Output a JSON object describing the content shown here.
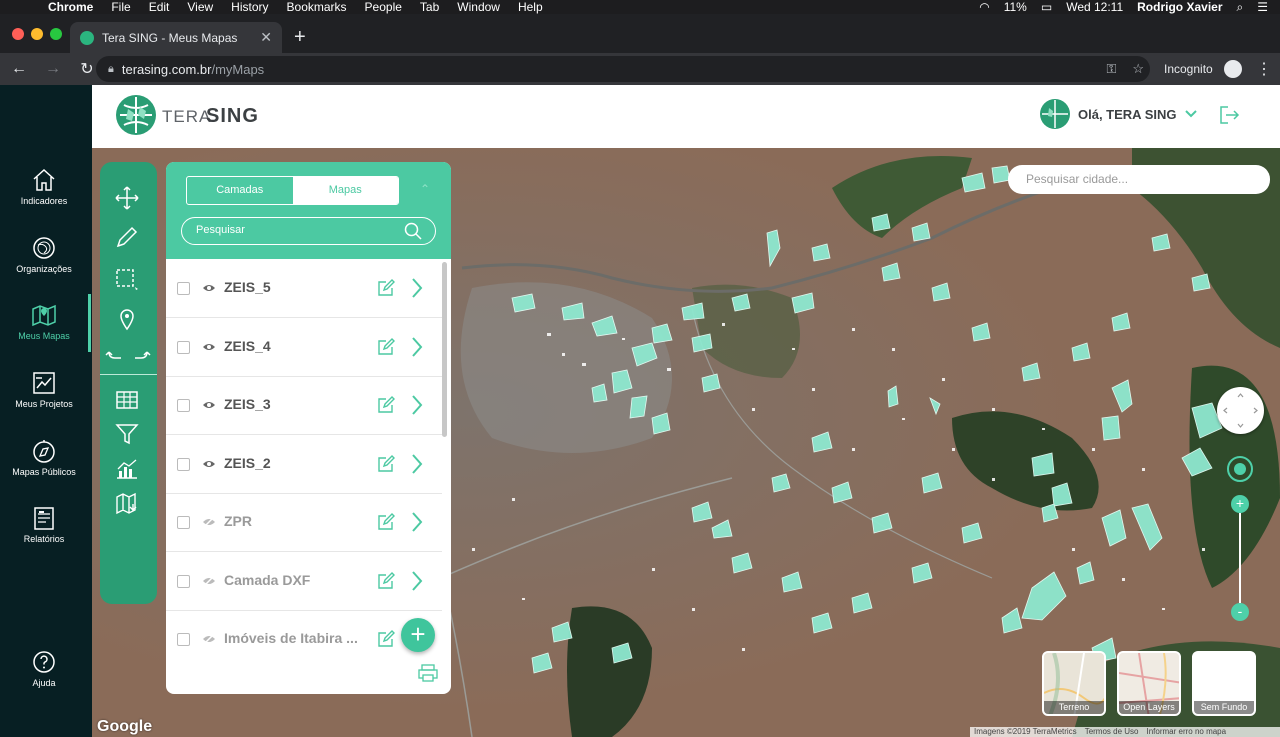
{
  "menubar": {
    "app": "Chrome",
    "items": [
      "File",
      "Edit",
      "View",
      "History",
      "Bookmarks",
      "People",
      "Tab",
      "Window",
      "Help"
    ],
    "battery": "11%",
    "clock": "Wed 12:11",
    "user": "Rodrigo Xavier"
  },
  "browser": {
    "tab_title": "Tera SING - Meus Mapas",
    "url_host": "terasing.com.br",
    "url_path": "/myMaps",
    "incognito_label": "Incognito"
  },
  "sidebar": {
    "items": [
      {
        "label": "Indicadores",
        "icon": "home-icon"
      },
      {
        "label": "Organizações",
        "icon": "globe-icon"
      },
      {
        "label": "Meus Mapas",
        "icon": "map-icon",
        "active": true
      },
      {
        "label": "Meus Projetos",
        "icon": "projects-icon"
      },
      {
        "label": "Mapas Públicos",
        "icon": "compass-icon"
      },
      {
        "label": "Relatórios",
        "icon": "report-icon"
      }
    ],
    "help_label": "Ajuda"
  },
  "header": {
    "logo_text_a": "TERA",
    "logo_text_b": "SING",
    "greeting": "Olá, TERA SING"
  },
  "panel": {
    "tabs": [
      "Camadas",
      "Mapas"
    ],
    "active_tab": "Camadas",
    "search_placeholder": "Pesquisar",
    "layers": [
      {
        "name": "ZEIS_5",
        "visible": true
      },
      {
        "name": "ZEIS_4",
        "visible": true
      },
      {
        "name": "ZEIS_3",
        "visible": true
      },
      {
        "name": "ZEIS_2",
        "visible": true
      },
      {
        "name": "ZPR",
        "visible": false
      },
      {
        "name": "Camada DXF",
        "visible": false
      },
      {
        "name": "Imóveis de Itabira ...",
        "visible": false
      }
    ],
    "add_label": "+"
  },
  "map": {
    "city_search_placeholder": "Pesquisar cidade...",
    "zoom_in": "+",
    "zoom_out": "-",
    "basemaps": [
      "Terreno",
      "Open Layers",
      "Sem Fundo"
    ],
    "google": "Google",
    "attribution": [
      "Imagens ©2019 TerraMetrics",
      "Termos de Uso",
      "Informar erro no mapa"
    ]
  },
  "colors": {
    "accent": "#4cc9a2",
    "toolbar": "#2a9d74",
    "sidebar_bg": "#071f23"
  }
}
